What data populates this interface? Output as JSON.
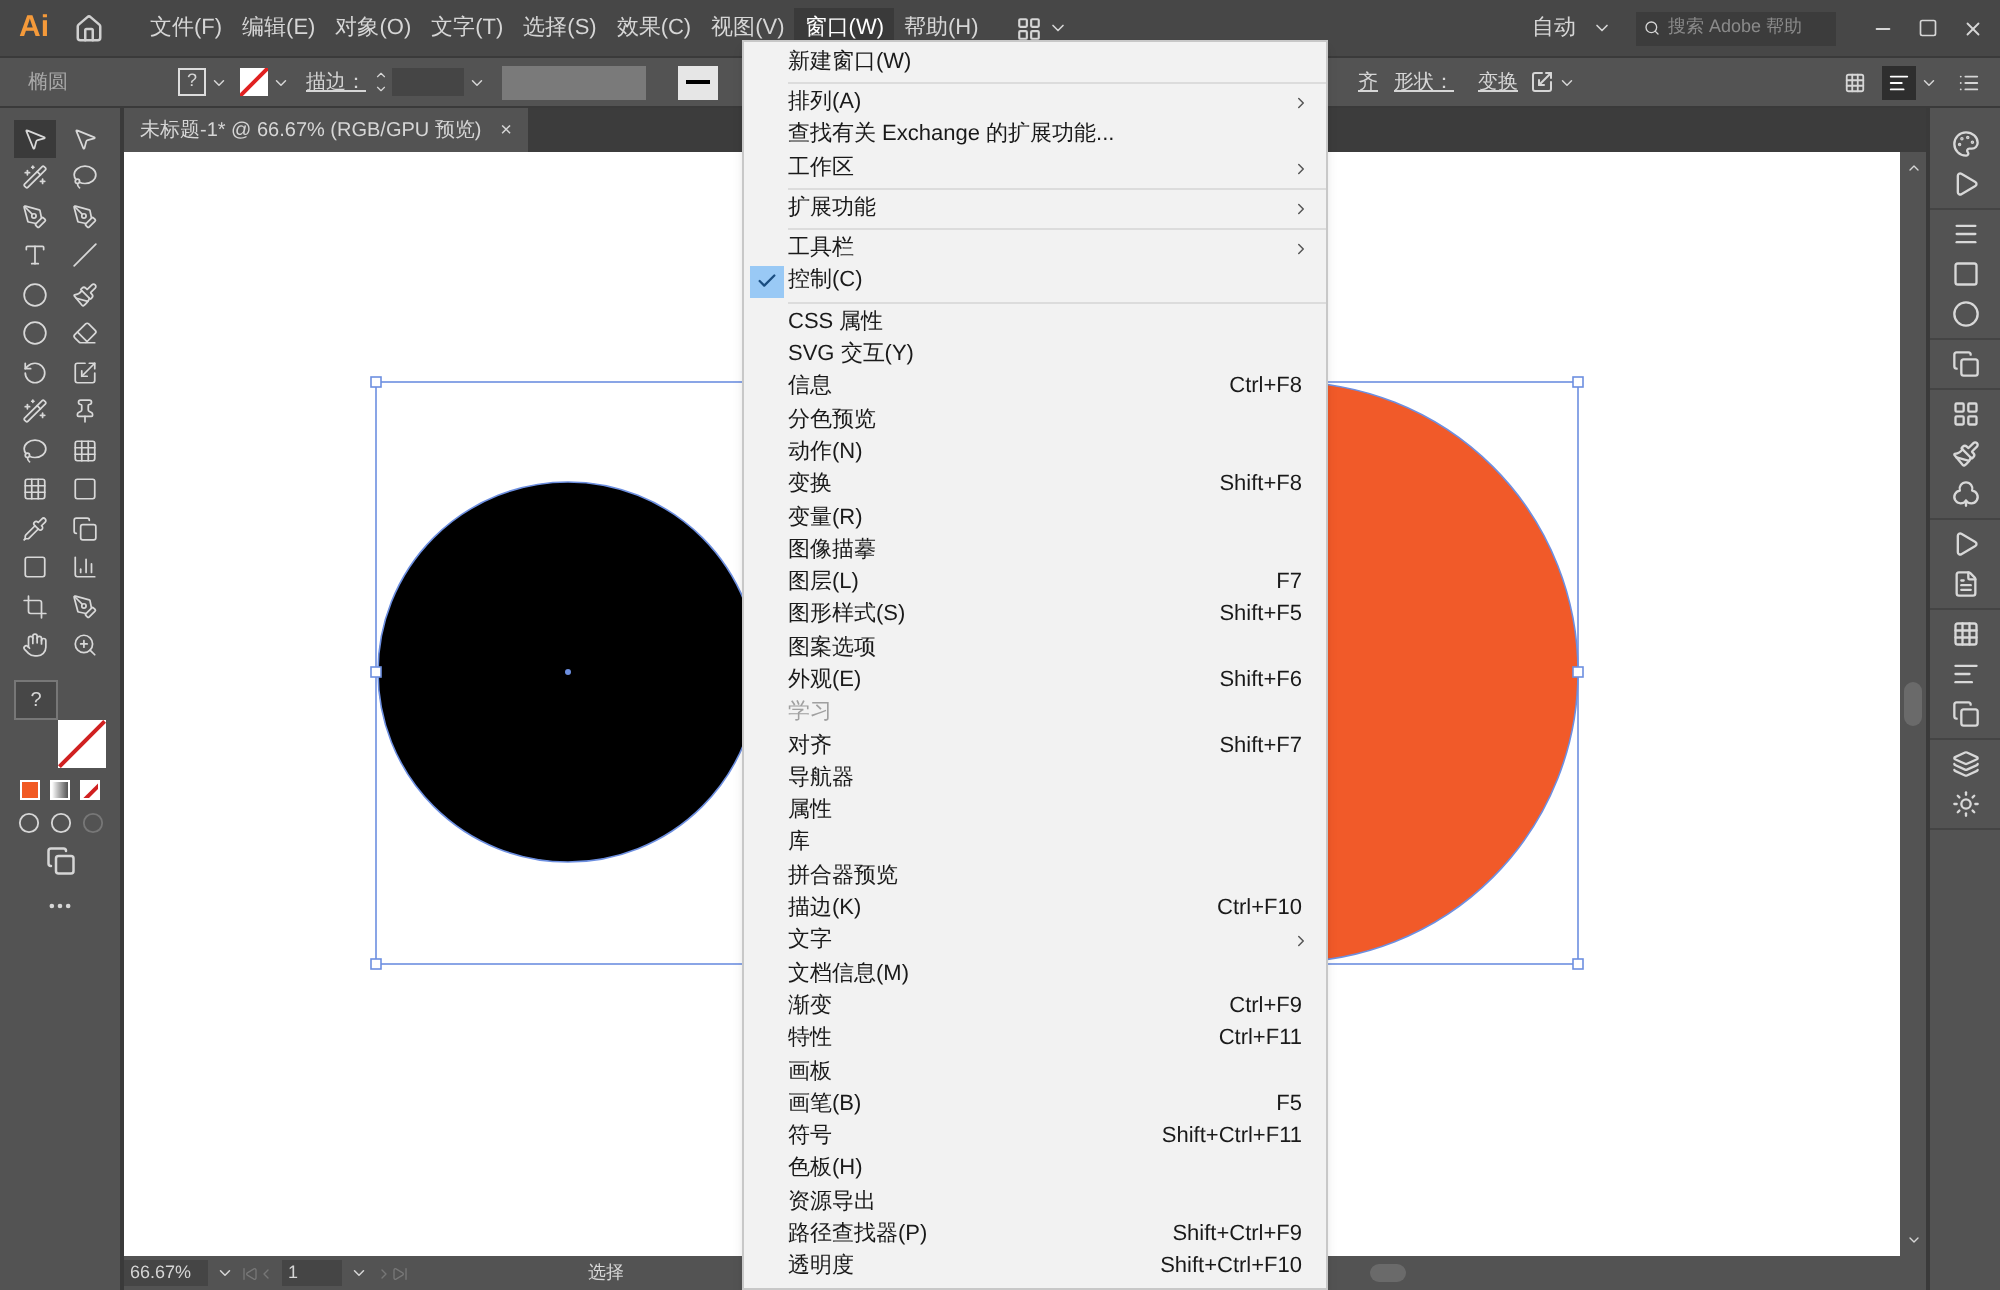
{
  "app": {
    "logo": "Ai"
  },
  "menubar": [
    {
      "label": "文件(F)",
      "selected": false
    },
    {
      "label": "编辑(E)",
      "selected": false
    },
    {
      "label": "对象(O)",
      "selected": false
    },
    {
      "label": "文字(T)",
      "selected": false
    },
    {
      "label": "选择(S)",
      "selected": false
    },
    {
      "label": "效果(C)",
      "selected": false
    },
    {
      "label": "视图(V)",
      "selected": false
    },
    {
      "label": "窗口(W)",
      "selected": true
    },
    {
      "label": "帮助(H)",
      "selected": false
    }
  ],
  "workspace": "自动",
  "search": {
    "placeholder": "搜索 Adobe 帮助"
  },
  "control_bar": {
    "object_type": "椭圆",
    "stroke_label": "描边：",
    "shape_label": "形状：",
    "transform_label": "变换",
    "cut_label": "齐"
  },
  "tab": {
    "title": "未标题-1* @ 66.67% (RGB/GPU 预览)",
    "close": "×"
  },
  "status_bar": {
    "zoom": "66.67%",
    "artboard": "1",
    "tool": "选择"
  },
  "window_menu": [
    {
      "kind": "item",
      "label": "新建窗口(W)",
      "checked": false,
      "disabled": false
    },
    {
      "kind": "separator"
    },
    {
      "kind": "submenu",
      "label": "排列(A)",
      "checked": false,
      "disabled": false
    },
    {
      "kind": "item",
      "label": "查找有关 Exchange 的扩展功能...",
      "checked": false,
      "disabled": false
    },
    {
      "kind": "submenu",
      "label": "工作区",
      "checked": false,
      "disabled": false
    },
    {
      "kind": "separator"
    },
    {
      "kind": "submenu",
      "label": "扩展功能",
      "checked": false,
      "disabled": false
    },
    {
      "kind": "separator"
    },
    {
      "kind": "submenu",
      "label": "工具栏",
      "checked": false,
      "disabled": false
    },
    {
      "kind": "item",
      "label": "控制(C)",
      "checked": true,
      "disabled": false
    },
    {
      "kind": "separator"
    },
    {
      "kind": "item",
      "label": "CSS 属性",
      "checked": false,
      "disabled": false
    },
    {
      "kind": "item",
      "label": "SVG 交互(Y)",
      "checked": false,
      "disabled": false
    },
    {
      "kind": "item",
      "label": "信息",
      "shortcut": "Ctrl+F8",
      "checked": false,
      "disabled": false
    },
    {
      "kind": "item",
      "label": "分色预览",
      "checked": false,
      "disabled": false
    },
    {
      "kind": "item",
      "label": "动作(N)",
      "checked": false,
      "disabled": false
    },
    {
      "kind": "item",
      "label": "变换",
      "shortcut": "Shift+F8",
      "checked": false,
      "disabled": false
    },
    {
      "kind": "item",
      "label": "变量(R)",
      "checked": false,
      "disabled": false
    },
    {
      "kind": "item",
      "label": "图像描摹",
      "checked": false,
      "disabled": false
    },
    {
      "kind": "item",
      "label": "图层(L)",
      "shortcut": "F7",
      "checked": false,
      "disabled": false
    },
    {
      "kind": "item",
      "label": "图形样式(S)",
      "shortcut": "Shift+F5",
      "checked": false,
      "disabled": false
    },
    {
      "kind": "item",
      "label": "图案选项",
      "checked": false,
      "disabled": false
    },
    {
      "kind": "item",
      "label": "外观(E)",
      "shortcut": "Shift+F6",
      "checked": false,
      "disabled": false
    },
    {
      "kind": "item",
      "label": "学习",
      "checked": false,
      "disabled": true
    },
    {
      "kind": "item",
      "label": "对齐",
      "shortcut": "Shift+F7",
      "checked": false,
      "disabled": false
    },
    {
      "kind": "item",
      "label": "导航器",
      "checked": false,
      "disabled": false
    },
    {
      "kind": "item",
      "label": "属性",
      "checked": false,
      "disabled": false
    },
    {
      "kind": "item",
      "label": "库",
      "checked": false,
      "disabled": false
    },
    {
      "kind": "item",
      "label": "拼合器预览",
      "checked": false,
      "disabled": false
    },
    {
      "kind": "item",
      "label": "描边(K)",
      "shortcut": "Ctrl+F10",
      "checked": false,
      "disabled": false
    },
    {
      "kind": "submenu",
      "label": "文字",
      "checked": false,
      "disabled": false
    },
    {
      "kind": "item",
      "label": "文档信息(M)",
      "checked": false,
      "disabled": false
    },
    {
      "kind": "item",
      "label": "渐变",
      "shortcut": "Ctrl+F9",
      "checked": false,
      "disabled": false
    },
    {
      "kind": "item",
      "label": "特性",
      "shortcut": "Ctrl+F11",
      "checked": false,
      "disabled": false
    },
    {
      "kind": "item",
      "label": "画板",
      "checked": false,
      "disabled": false
    },
    {
      "kind": "item",
      "label": "画笔(B)",
      "shortcut": "F5",
      "checked": false,
      "disabled": false
    },
    {
      "kind": "item",
      "label": "符号",
      "shortcut": "Shift+Ctrl+F11",
      "checked": false,
      "disabled": false
    },
    {
      "kind": "item",
      "label": "色板(H)",
      "checked": false,
      "disabled": false
    },
    {
      "kind": "item",
      "label": "资源导出",
      "checked": false,
      "disabled": false
    },
    {
      "kind": "item",
      "label": "路径查找器(P)",
      "shortcut": "Shift+Ctrl+F9",
      "checked": false,
      "disabled": false
    },
    {
      "kind": "item",
      "label": "透明度",
      "shortcut": "Shift+Ctrl+F10",
      "checked": false,
      "disabled": false
    }
  ],
  "color_controls": {
    "fill_unknown": "?"
  },
  "artwork": [
    {
      "kind": "circle",
      "color": "#000000"
    },
    {
      "kind": "circle",
      "color": "#f15a29"
    }
  ]
}
